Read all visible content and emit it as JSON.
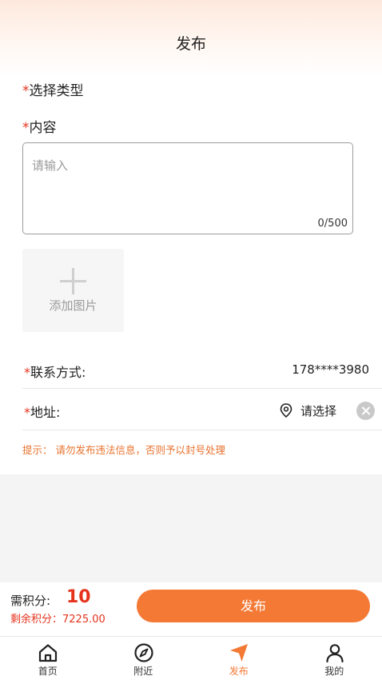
{
  "header": {
    "title": "发布"
  },
  "form": {
    "required_mark": "*",
    "type_label": "选择类型",
    "content_label": "内容",
    "content_placeholder": "请输入",
    "content_counter": "0/500",
    "add_image_label": "添加图片",
    "contact_label": "联系方式:",
    "contact_value": "178****3980",
    "address_label": "地址:",
    "address_select_label": "请选择",
    "tip": "提示：  请勿发布违法信息，否则予以封号处理"
  },
  "publish_bar": {
    "points_label": "需积分:",
    "points_value": "10",
    "remaining_label": "剩余积分：7225.00",
    "publish_button": "发布"
  },
  "tabbar": {
    "active_index": 2,
    "tabs": [
      {
        "label": "首页",
        "icon": "home-icon"
      },
      {
        "label": "附近",
        "icon": "compass-icon"
      },
      {
        "label": "发布",
        "icon": "send-icon"
      },
      {
        "label": "我的",
        "icon": "user-icon"
      }
    ]
  },
  "colors": {
    "accent": "#f37935",
    "required": "#e5331d",
    "tip": "#e8732f"
  }
}
